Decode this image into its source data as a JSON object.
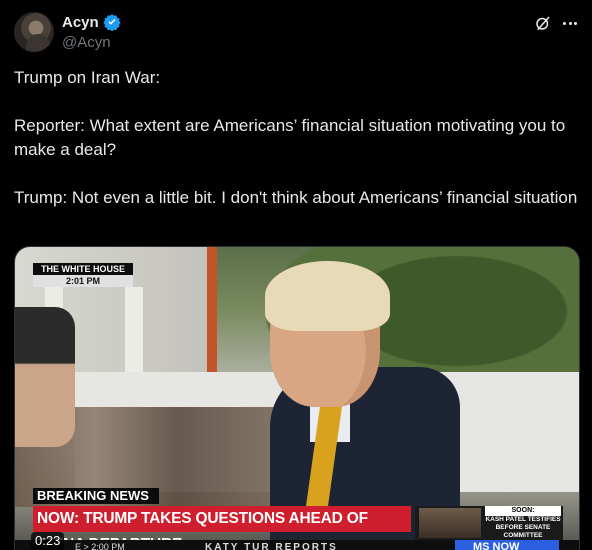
{
  "author": {
    "display_name": "Acyn",
    "handle": "@Acyn"
  },
  "colors": {
    "verified": "#1d9bf0",
    "headline_bg": "#cf1f2e",
    "msnow_bg": "#2c5fe0"
  },
  "icons": {
    "verified": "verified-badge-icon",
    "grok": "grok-icon",
    "more": "more-icon"
  },
  "tweet": {
    "line1": "Trump on Iran War:",
    "line2": "Reporter: What extent are Americans’ financial situation motivating you to make a deal?",
    "line3": "Trump: Not even a little bit. I don't think about Americans’ financial situation"
  },
  "video": {
    "location_tag": "THE WHITE HOUSE",
    "location_time": "2:01 PM",
    "breaking_label": "BREAKING NEWS",
    "headline": "NOW: TRUMP TAKES QUESTIONS AHEAD OF CHINA DEPARTURE",
    "soon_label": "SOON:",
    "soon_text": "KASH PATEL TESTIFIES BEFORE SENATE COMMITTEE",
    "ticker_time": "E > 2:00 PM",
    "show_name": "KATY TUR REPORTS",
    "network": "MS NOW",
    "duration": "0:23"
  }
}
